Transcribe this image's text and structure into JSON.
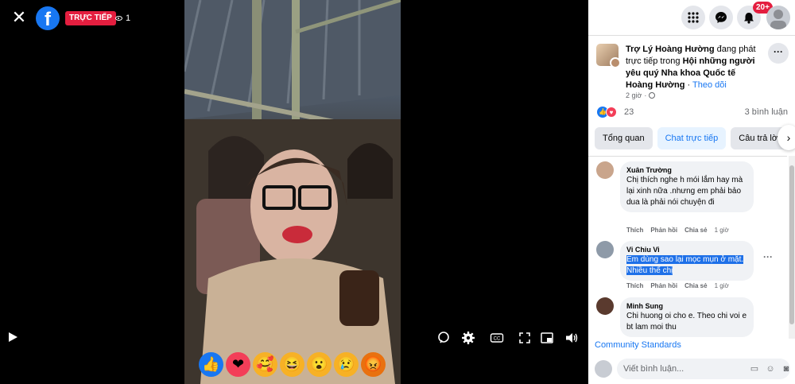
{
  "video": {
    "live_label": "TRỰC TIẾP",
    "viewer_count": "1",
    "reactions": [
      {
        "name": "like",
        "color": "#1877f2",
        "glyph": "👍"
      },
      {
        "name": "love",
        "color": "#f33e58",
        "glyph": "❤"
      },
      {
        "name": "care",
        "color": "#f7b125",
        "glyph": "🥰"
      },
      {
        "name": "haha",
        "color": "#f7b125",
        "glyph": "😆"
      },
      {
        "name": "wow",
        "color": "#f7b125",
        "glyph": "😮"
      },
      {
        "name": "sad",
        "color": "#f7b125",
        "glyph": "😢"
      },
      {
        "name": "angry",
        "color": "#e9710f",
        "glyph": "😡"
      }
    ]
  },
  "topbar": {
    "notification_badge": "20+"
  },
  "post": {
    "author": "Trợ Lý Hoàng Hường",
    "action_text": " đang phát trực tiếp trong ",
    "group": "Hội những người yêu quý Nha khoa Quốc tế Hoàng Hường",
    "separator": " · ",
    "follow": "Theo dõi",
    "time": "2 giờ",
    "reaction_count": "23",
    "comment_count": "3 bình luận"
  },
  "tabs": [
    {
      "label": "Tổng quan"
    },
    {
      "label": "Chat trực tiếp"
    },
    {
      "label": "Câu trả lời"
    }
  ],
  "comments": [
    {
      "name": "Xuân Trường",
      "text": "Chị thích nghe h mói lắm hay mà lại xinh nữa .nhưng em phải bảo dua là phải nói chuyện đi",
      "actions": [
        "Thích",
        "Phản hồi",
        "Chia sẻ"
      ],
      "time": "1 giờ"
    },
    {
      "name": "Vi Chiu Vi",
      "text": "Em dùng sao lại mọc mụn ở mặt. Nhiều thế chị",
      "actions": [
        "Thích",
        "Phản hồi",
        "Chia sẻ"
      ],
      "time": "1 giờ"
    },
    {
      "name": "Minh Sung",
      "text": "Chi huong oi cho e. Theo chi voi e bt lam moi thu",
      "actions": [],
      "time": ""
    }
  ],
  "footer": {
    "community_standards": "Community Standards",
    "comment_placeholder": "Viết bình luận..."
  },
  "colors": {
    "brand": "#1877f2",
    "live_red": "#e41e3f",
    "panel_bg": "#ffffff",
    "bubble_bg": "#f0f2f5",
    "selection": "#1e70e8"
  }
}
